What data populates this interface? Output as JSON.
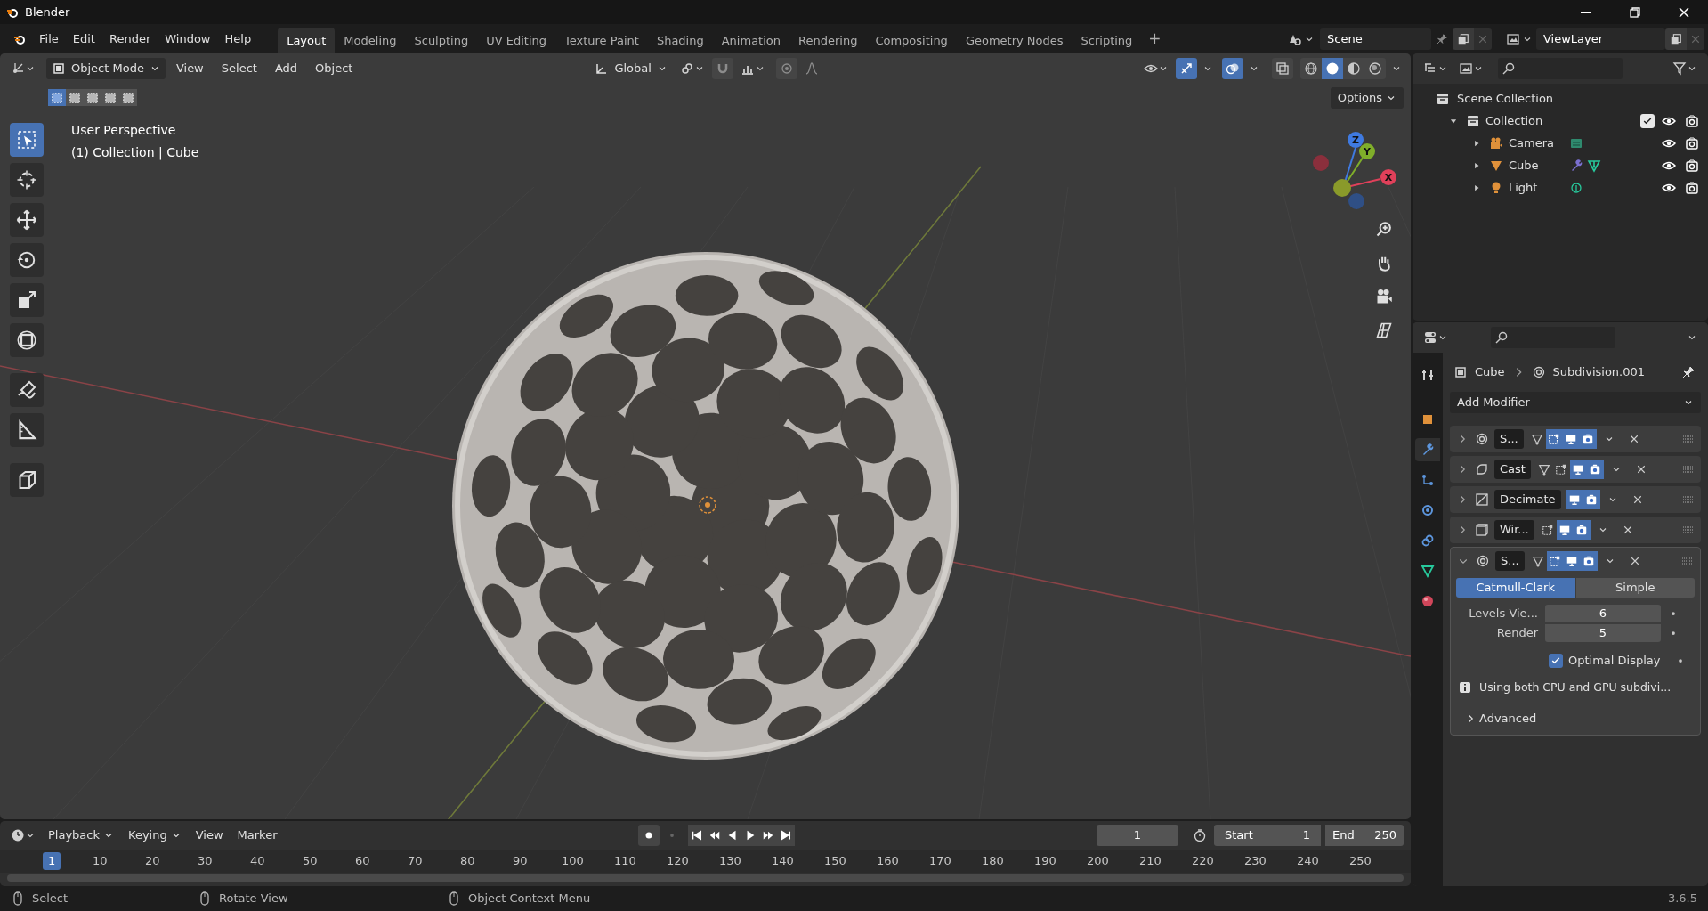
{
  "window": {
    "title": "Blender"
  },
  "menu": [
    "File",
    "Edit",
    "Render",
    "Window",
    "Help"
  ],
  "workspaces": [
    {
      "label": "Layout",
      "selected": true
    },
    {
      "label": "Modeling",
      "selected": false
    },
    {
      "label": "Sculpting",
      "selected": false
    },
    {
      "label": "UV Editing",
      "selected": false
    },
    {
      "label": "Texture Paint",
      "selected": false
    },
    {
      "label": "Shading",
      "selected": false
    },
    {
      "label": "Animation",
      "selected": false
    },
    {
      "label": "Rendering",
      "selected": false
    },
    {
      "label": "Compositing",
      "selected": false
    },
    {
      "label": "Geometry Nodes",
      "selected": false
    },
    {
      "label": "Scripting",
      "selected": false
    }
  ],
  "add_workspace": "+",
  "scene": "Scene",
  "view_layer": "ViewLayer",
  "viewport": {
    "mode": "Object Mode",
    "menus": [
      "View",
      "Select",
      "Add",
      "Object"
    ],
    "orientation": "Global",
    "shading": [
      {
        "kind": "wireframe",
        "selected": false
      },
      {
        "kind": "solid",
        "selected": true
      },
      {
        "kind": "material",
        "selected": false
      },
      {
        "kind": "rendered",
        "selected": false
      }
    ],
    "select_modes": [
      {
        "selected": true
      },
      {
        "selected": false
      },
      {
        "selected": false
      },
      {
        "selected": false
      },
      {
        "selected": false
      }
    ],
    "options": "Options",
    "view_name": "User Perspective",
    "view_info": "(1) Collection | Cube",
    "tools": [
      {
        "kind": "select",
        "selected": true
      },
      {
        "kind": "cursor",
        "selected": false
      },
      {
        "kind": "move",
        "selected": false
      },
      {
        "kind": "rotate",
        "selected": false
      },
      {
        "kind": "scale",
        "selected": false
      },
      {
        "kind": "transform",
        "selected": false
      },
      {
        "kind": "annotate",
        "selected": false
      },
      {
        "kind": "measure",
        "selected": false
      },
      {
        "kind": "add-cube",
        "selected": false
      }
    ],
    "gizmo": {
      "z": "Z",
      "y": "Y",
      "x": "X"
    }
  },
  "outliner": {
    "root": "Scene Collection",
    "items": [
      {
        "label": "Collection",
        "kind": "collection",
        "expanded": true,
        "checked": true,
        "children": [
          {
            "label": "Camera",
            "kind": "camera",
            "expanded": false
          },
          {
            "label": "Cube",
            "kind": "mesh",
            "expanded": false
          },
          {
            "label": "Light",
            "kind": "light",
            "expanded": false
          }
        ]
      }
    ]
  },
  "properties": {
    "tabs": [
      {
        "kind": "tool",
        "selected": false
      },
      {
        "kind": "object",
        "selected": false
      },
      {
        "kind": "modifier",
        "selected": true
      },
      {
        "kind": "particles",
        "selected": false
      },
      {
        "kind": "physics",
        "selected": false
      },
      {
        "kind": "constraints",
        "selected": false
      },
      {
        "kind": "data",
        "selected": false
      },
      {
        "kind": "material",
        "selected": false
      }
    ],
    "breadcrumb": [
      "Cube",
      "Subdivision.001"
    ],
    "add_modifier": "Add Modifier",
    "modifiers": [
      {
        "name": "S...",
        "kind": "subdivision",
        "expanded": false,
        "toggles": [
          {
            "kind": "cage",
            "on": false
          },
          {
            "kind": "editmode",
            "on": true
          },
          {
            "kind": "viewport",
            "on": true
          },
          {
            "kind": "render",
            "on": true
          }
        ]
      },
      {
        "name": "Cast",
        "kind": "cast",
        "expanded": false,
        "toggles": [
          {
            "kind": "cage",
            "on": false
          },
          {
            "kind": "editmode",
            "on": false
          },
          {
            "kind": "viewport",
            "on": true
          },
          {
            "kind": "render",
            "on": true
          }
        ]
      },
      {
        "name": "Decimate",
        "kind": "decimate",
        "expanded": false,
        "toggles": [
          {
            "kind": "viewport",
            "on": true
          },
          {
            "kind": "render",
            "on": true
          }
        ]
      },
      {
        "name": "Wir...",
        "kind": "wireframe",
        "expanded": false,
        "toggles": [
          {
            "kind": "editmode",
            "on": false
          },
          {
            "kind": "viewport",
            "on": true
          },
          {
            "kind": "render",
            "on": true
          }
        ]
      },
      {
        "name": "S...",
        "kind": "subdivision",
        "expanded": true,
        "toggles": [
          {
            "kind": "cage",
            "on": false
          },
          {
            "kind": "editmode",
            "on": true
          },
          {
            "kind": "viewport",
            "on": true
          },
          {
            "kind": "render",
            "on": true
          }
        ],
        "methods": [
          {
            "label": "Catmull-Clark",
            "selected": true
          },
          {
            "label": "Simple",
            "selected": false
          }
        ],
        "fields": [
          {
            "label": "Levels Vie...",
            "value": "6"
          },
          {
            "label": "Render",
            "value": "5"
          }
        ],
        "optimal_display": {
          "label": "Optimal Display",
          "checked": true
        },
        "info": "Using both CPU and GPU subdivi...",
        "advanced": {
          "label": "Advanced",
          "expanded": false
        }
      }
    ]
  },
  "timeline": {
    "menus": [
      {
        "label": "Playback",
        "kind": "dropdown"
      },
      {
        "label": "Keying",
        "kind": "dropdown"
      },
      {
        "label": "View",
        "kind": "menu"
      },
      {
        "label": "Marker",
        "kind": "menu"
      }
    ],
    "current_frame": "1",
    "start_label": "Start",
    "start": "1",
    "end_label": "End",
    "end": "250",
    "ruler": [
      "1",
      "10",
      "20",
      "30",
      "40",
      "50",
      "60",
      "70",
      "80",
      "90",
      "100",
      "110",
      "120",
      "130",
      "140",
      "150",
      "160",
      "170",
      "180",
      "190",
      "200",
      "210",
      "220",
      "230",
      "240",
      "250"
    ]
  },
  "status_bar": {
    "hints": [
      "Select",
      "Rotate View",
      "Object Context Menu"
    ],
    "version": "3.6.5"
  }
}
